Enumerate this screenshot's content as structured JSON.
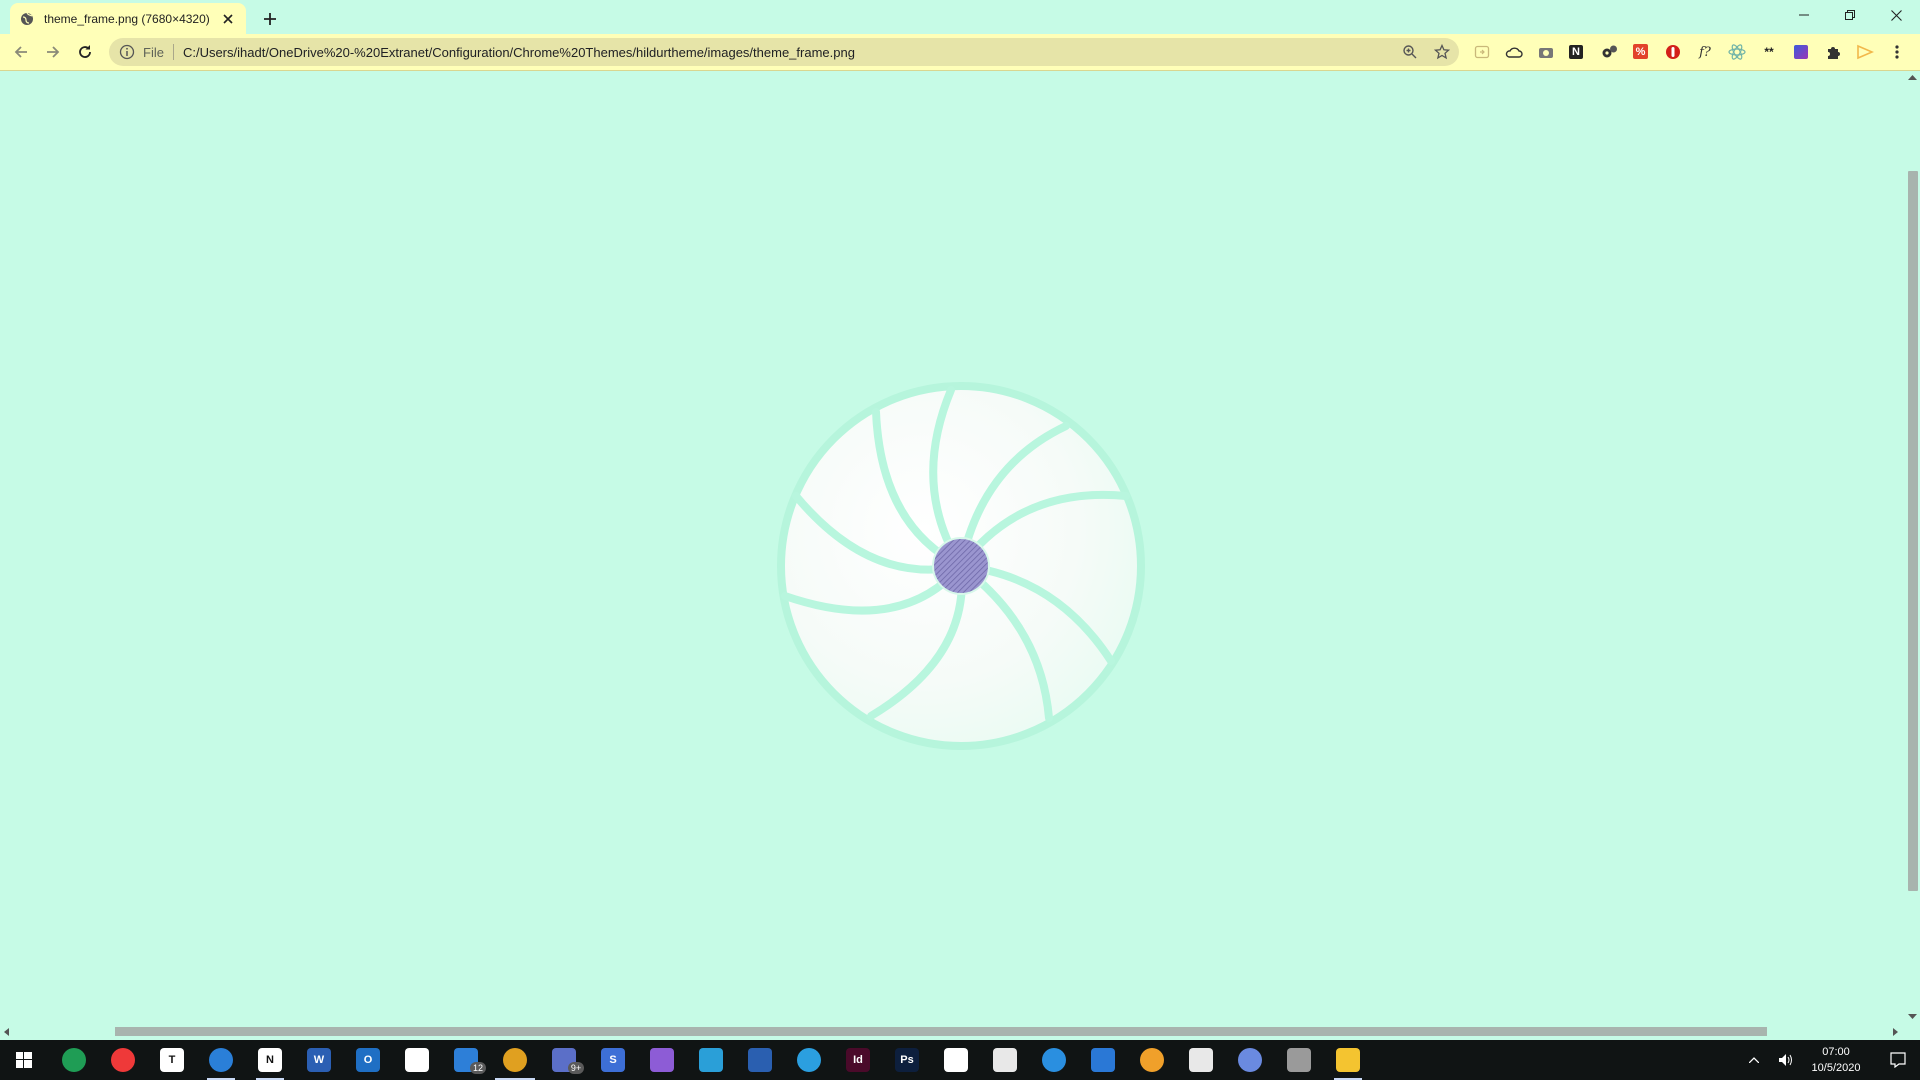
{
  "tab": {
    "title": "theme_frame.png (7680×4320)"
  },
  "toolbar": {
    "scheme_label": "File",
    "url": "C:/Users/ihadt/OneDrive%20-%20Extranet/Configuration/Chrome%20Themes/hildurtheme/images/theme_frame.png"
  },
  "extensions": [
    {
      "name": "reader-mode-icon"
    },
    {
      "name": "cloud-icon"
    },
    {
      "name": "camera-icon"
    },
    {
      "name": "notion-ext-icon",
      "glyph": "N"
    },
    {
      "name": "gears-icon"
    },
    {
      "name": "percent-ext-icon",
      "glyph": "%"
    },
    {
      "name": "shield-ext-icon"
    },
    {
      "name": "function-ext-icon",
      "glyph": "f?"
    },
    {
      "name": "react-ext-icon"
    },
    {
      "name": "asterisk-ext-icon",
      "glyph": "**"
    },
    {
      "name": "gradient-ext-icon"
    },
    {
      "name": "puzzle-icon"
    },
    {
      "name": "play-ext-icon"
    },
    {
      "name": "menu-kebab-icon"
    }
  ],
  "taskbar": {
    "apps": [
      {
        "name": "edge-dev-icon",
        "color": "#1f9d55"
      },
      {
        "name": "vivaldi-icon",
        "color": "#ef3939"
      },
      {
        "name": "typora-icon",
        "glyph": "T",
        "color": "#ffffff"
      },
      {
        "name": "firefox-icon",
        "color": "#2a7fd8"
      },
      {
        "name": "notion-icon",
        "glyph": "N",
        "color": "#ffffff"
      },
      {
        "name": "word-icon",
        "glyph": "W",
        "color": "#2b5fb3"
      },
      {
        "name": "outlook-icon",
        "glyph": "O",
        "color": "#1f6fc4"
      },
      {
        "name": "bitwarden-icon",
        "color": "#ffffff"
      },
      {
        "name": "todo-icon",
        "badge": "12",
        "color": "#2d7fd8"
      },
      {
        "name": "chrome-icon",
        "color": "#e0a020"
      },
      {
        "name": "discord-icon",
        "badge": "9+",
        "color": "#5b6fc8"
      },
      {
        "name": "simplenote-icon",
        "glyph": "S",
        "color": "#3d6fd6"
      },
      {
        "name": "visual-studio-icon",
        "color": "#8d5cd6"
      },
      {
        "name": "vscode-icon",
        "color": "#2a9fd8"
      },
      {
        "name": "powershell-icon",
        "color": "#2a5fb0"
      },
      {
        "name": "telegram-icon",
        "color": "#2b9fe0"
      },
      {
        "name": "indesign-icon",
        "glyph": "Id",
        "color": "#4a0a2a"
      },
      {
        "name": "photoshop-icon",
        "glyph": "Ps",
        "color": "#0d1f3d"
      },
      {
        "name": "inkscape-icon",
        "color": "#ffffff"
      },
      {
        "name": "app-manager-icon",
        "color": "#e8e8e8"
      },
      {
        "name": "onedrive-icon",
        "color": "#2a8fe0"
      },
      {
        "name": "mail-icon",
        "color": "#2a78d6"
      },
      {
        "name": "firefox-alt-icon",
        "color": "#f0a02a"
      },
      {
        "name": "slack-icon",
        "color": "#e8e8e8"
      },
      {
        "name": "podcast-icon",
        "color": "#6a8ae0"
      },
      {
        "name": "terminal-icon",
        "color": "#9a9a9a"
      },
      {
        "name": "file-explorer-icon",
        "color": "#f4c430"
      }
    ],
    "clock_time": "07:00",
    "clock_date": "10/5/2020"
  },
  "colors": {
    "frame": "#c6fbe6",
    "toolbar": "#ffffb8",
    "omnibox": "#e6e4a8",
    "taskbar": "#101414",
    "hub_purple": "#8b85c4"
  }
}
